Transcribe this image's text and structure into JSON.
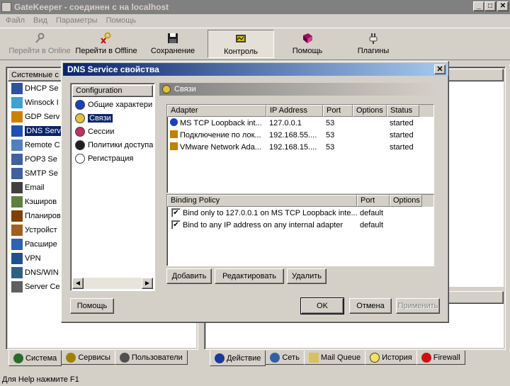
{
  "window": {
    "title": "GateKeeper - соединен с на localhost",
    "min": "_",
    "max": "□",
    "close": "✕"
  },
  "menu": [
    "Файл",
    "Вид",
    "Параметры",
    "Помощь"
  ],
  "toolbar": [
    {
      "label": "Перейти в Online",
      "icon": "key-icon",
      "disabled": true
    },
    {
      "label": "Перейти в Offline",
      "icon": "key-x-icon",
      "disabled": false
    },
    {
      "label": "Сохранение",
      "icon": "floppy-icon",
      "disabled": false
    },
    {
      "label": "Контроль",
      "icon": "monitor-icon",
      "disabled": false,
      "active": true
    },
    {
      "label": "Помощь",
      "icon": "book-icon",
      "disabled": false
    },
    {
      "label": "Плагины",
      "icon": "plug-icon",
      "disabled": false
    }
  ],
  "left_panel": {
    "header": "Системные с",
    "items": [
      "DHCP Se",
      "Winsock I",
      "GDP Serv",
      "DNS Serv",
      "Remote C",
      "POP3 Se",
      "SMTP Se",
      "Email",
      "Кэширов",
      "Планиров",
      "Устройст",
      "Расшире",
      "VPN",
      "DNS/WIN",
      "Server Ce"
    ],
    "selected": 3,
    "tabs": [
      "Система",
      "Сервисы",
      "Пользователи"
    ]
  },
  "right_panel": {
    "tabs": [
      "Действие",
      "Сеть",
      "Mail Queue",
      "История",
      "Firewall"
    ]
  },
  "status": "Для Help нажмите F1",
  "dialog": {
    "title": "DNS Service свойства",
    "close": "✕",
    "config_header": "Configuration",
    "config_items": [
      "Общие характери",
      "Связи",
      "Сессии",
      "Политики доступа",
      "Регистрация"
    ],
    "config_selected": 1,
    "section_title": "Связи",
    "adapters": {
      "columns": [
        "Adapter",
        "IP Address",
        "Port",
        "Options",
        "Status"
      ],
      "rows": [
        {
          "adapter": "MS TCP Loopback int...",
          "ip": "127.0.0.1",
          "port": "53",
          "options": "",
          "status": "started"
        },
        {
          "adapter": "Подключение по лок...",
          "ip": "192.168.55....",
          "port": "53",
          "options": "",
          "status": "started"
        },
        {
          "adapter": "VMware Network Ada...",
          "ip": "192.168.15....",
          "port": "53",
          "options": "",
          "status": "started"
        }
      ]
    },
    "bindings": {
      "columns": [
        "Binding Policy",
        "Port",
        "Options"
      ],
      "rows": [
        {
          "policy": "Bind only to 127.0.0.1 on MS TCP Loopback inte...",
          "port": "default",
          "checked": true
        },
        {
          "policy": "Bind to any IP address on any internal adapter",
          "port": "default",
          "checked": true
        }
      ]
    },
    "buttons": {
      "add": "Добавить",
      "edit": "Редактировать",
      "delete": "Удалить",
      "help": "Помощь",
      "ok": "OK",
      "cancel": "Отмена",
      "apply": "Применить"
    }
  },
  "colors": {
    "face": "#d4d0c8",
    "title_active": "#0a246a",
    "selection": "#0a246a"
  }
}
